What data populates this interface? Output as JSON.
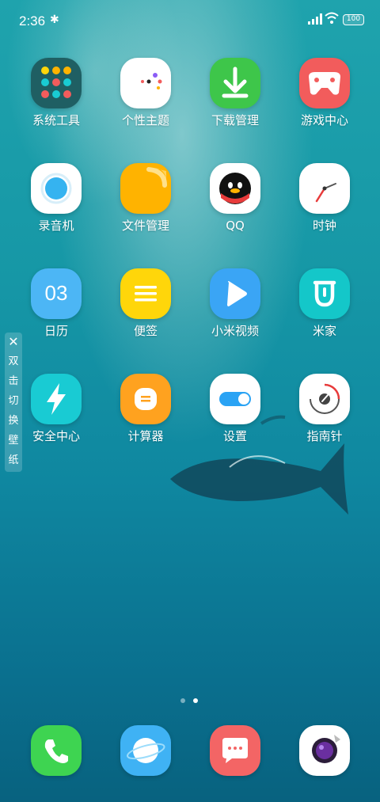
{
  "status_bar": {
    "time": "2:36",
    "battery": "100",
    "icons": [
      "bluetooth-icon",
      "signal-icon",
      "wifi-icon",
      "battery-icon"
    ]
  },
  "apps": [
    {
      "label": "系统工具",
      "icon": "system-tools-folder-icon"
    },
    {
      "label": "个性主题",
      "icon": "theme-icon"
    },
    {
      "label": "下载管理",
      "icon": "download-icon"
    },
    {
      "label": "游戏中心",
      "icon": "gamepad-icon"
    },
    {
      "label": "录音机",
      "icon": "recorder-icon"
    },
    {
      "label": "文件管理",
      "icon": "file-manager-icon"
    },
    {
      "label": "QQ",
      "icon": "qq-penguin-icon"
    },
    {
      "label": "时钟",
      "icon": "clock-icon"
    },
    {
      "label": "日历",
      "icon": "calendar-icon",
      "icon_text": "03"
    },
    {
      "label": "便签",
      "icon": "notes-icon"
    },
    {
      "label": "小米视频",
      "icon": "video-play-icon"
    },
    {
      "label": "米家",
      "icon": "mijia-icon"
    },
    {
      "label": "安全中心",
      "icon": "security-bolt-icon"
    },
    {
      "label": "计算器",
      "icon": "calculator-icon"
    },
    {
      "label": "设置",
      "icon": "settings-toggle-icon"
    },
    {
      "label": "指南针",
      "icon": "compass-icon"
    }
  ],
  "side_tab": {
    "chars": [
      "双",
      "击",
      "切",
      "换",
      "壁",
      "纸"
    ]
  },
  "page_indicator": {
    "count": 2,
    "active": 2
  },
  "dock": [
    {
      "icon": "phone-icon"
    },
    {
      "icon": "browser-icon"
    },
    {
      "icon": "messages-icon"
    },
    {
      "icon": "camera-icon"
    }
  ],
  "colors": {
    "download": "#3ec64a",
    "game": "#f25c5c",
    "files": "#ffb300",
    "notes": "#ffd60a",
    "video": "#2f9cf5",
    "mijia": "#14c7c9",
    "security": "#19cbd3",
    "calculator": "#ffa21f",
    "settings_toggle": "#2aa3f4",
    "phone": "#3ed451",
    "browser": "#3fb2f4",
    "messages": "#f36565"
  }
}
